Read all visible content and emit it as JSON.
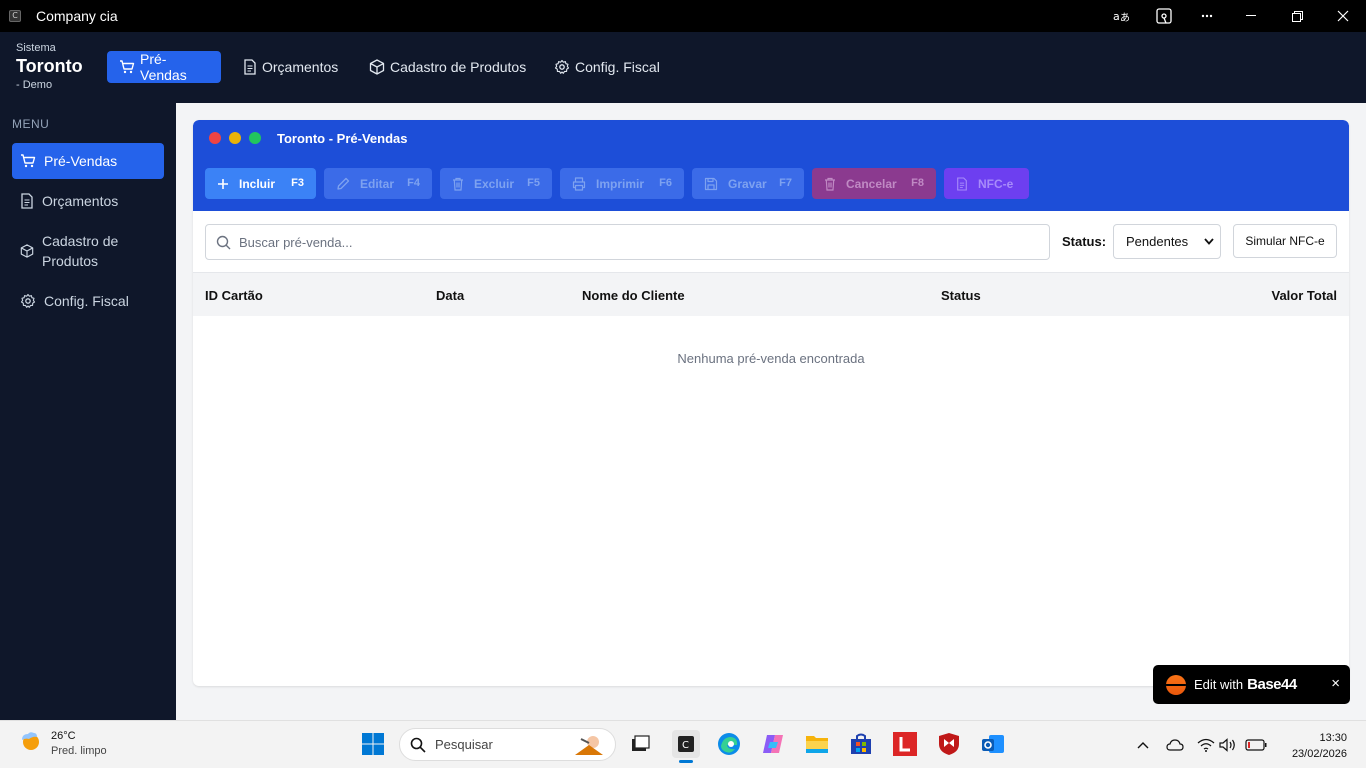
{
  "window": {
    "title": "Company cia",
    "app_icon_letter": "C"
  },
  "brand": {
    "subtitle": "Sistema",
    "name": "Toronto",
    "suffix": "- Demo"
  },
  "topnav": {
    "items": [
      {
        "label": "Pré-Vendas",
        "icon": "cart-icon",
        "active": true
      },
      {
        "label": "Orçamentos",
        "icon": "document-icon"
      },
      {
        "label": "Cadastro de Produtos",
        "icon": "box-icon"
      },
      {
        "label": "Config. Fiscal",
        "icon": "gear-icon"
      }
    ]
  },
  "sidebar": {
    "title": "MENU",
    "items": [
      {
        "label": "Pré-Vendas",
        "icon": "cart-icon",
        "active": true
      },
      {
        "label": "Orçamentos",
        "icon": "document-icon"
      },
      {
        "label": "Cadastro de Produtos",
        "icon": "box-icon"
      },
      {
        "label": "Config. Fiscal",
        "icon": "gear-icon"
      }
    ]
  },
  "panel": {
    "title": "Toronto - Pré-Vendas",
    "toolbar": [
      {
        "label": "Incluir",
        "key": "F3",
        "icon": "plus-icon",
        "enabled": true
      },
      {
        "label": "Editar",
        "key": "F4",
        "icon": "pencil-icon",
        "enabled": false
      },
      {
        "label": "Excluir",
        "key": "F5",
        "icon": "trash-icon",
        "enabled": false
      },
      {
        "label": "Imprimir",
        "key": "F6",
        "icon": "printer-icon",
        "enabled": false
      },
      {
        "label": "Gravar",
        "key": "F7",
        "icon": "save-icon",
        "enabled": false
      },
      {
        "label": "Cancelar",
        "key": "F8",
        "icon": "trash-icon",
        "enabled": false
      },
      {
        "label": "NFC-e",
        "key": "",
        "icon": "document-icon",
        "enabled": false
      }
    ],
    "search_placeholder": "Buscar pré-venda...",
    "status_label": "Status:",
    "status_value": "Pendentes",
    "simulate_button": "Simular NFC-e",
    "columns": [
      "ID Cartão",
      "Data",
      "Nome do Cliente",
      "Status",
      "Valor Total"
    ],
    "rows": [],
    "empty_message": "Nenhuma pré-venda encontrada"
  },
  "badge": {
    "prefix": "Edit with",
    "brand": "Base44",
    "close": "×"
  },
  "taskbar": {
    "weather": {
      "temp": "26°C",
      "desc": "Pred. limpo"
    },
    "search_label": "Pesquisar",
    "clock_time": "13:30",
    "clock_date": "23/02/2026"
  },
  "colors": {
    "primary": "#2563eb",
    "header": "#1d4ed8",
    "nav_bg": "#0f172a",
    "cancel": "#be185d",
    "nfce": "#7c3aed"
  }
}
